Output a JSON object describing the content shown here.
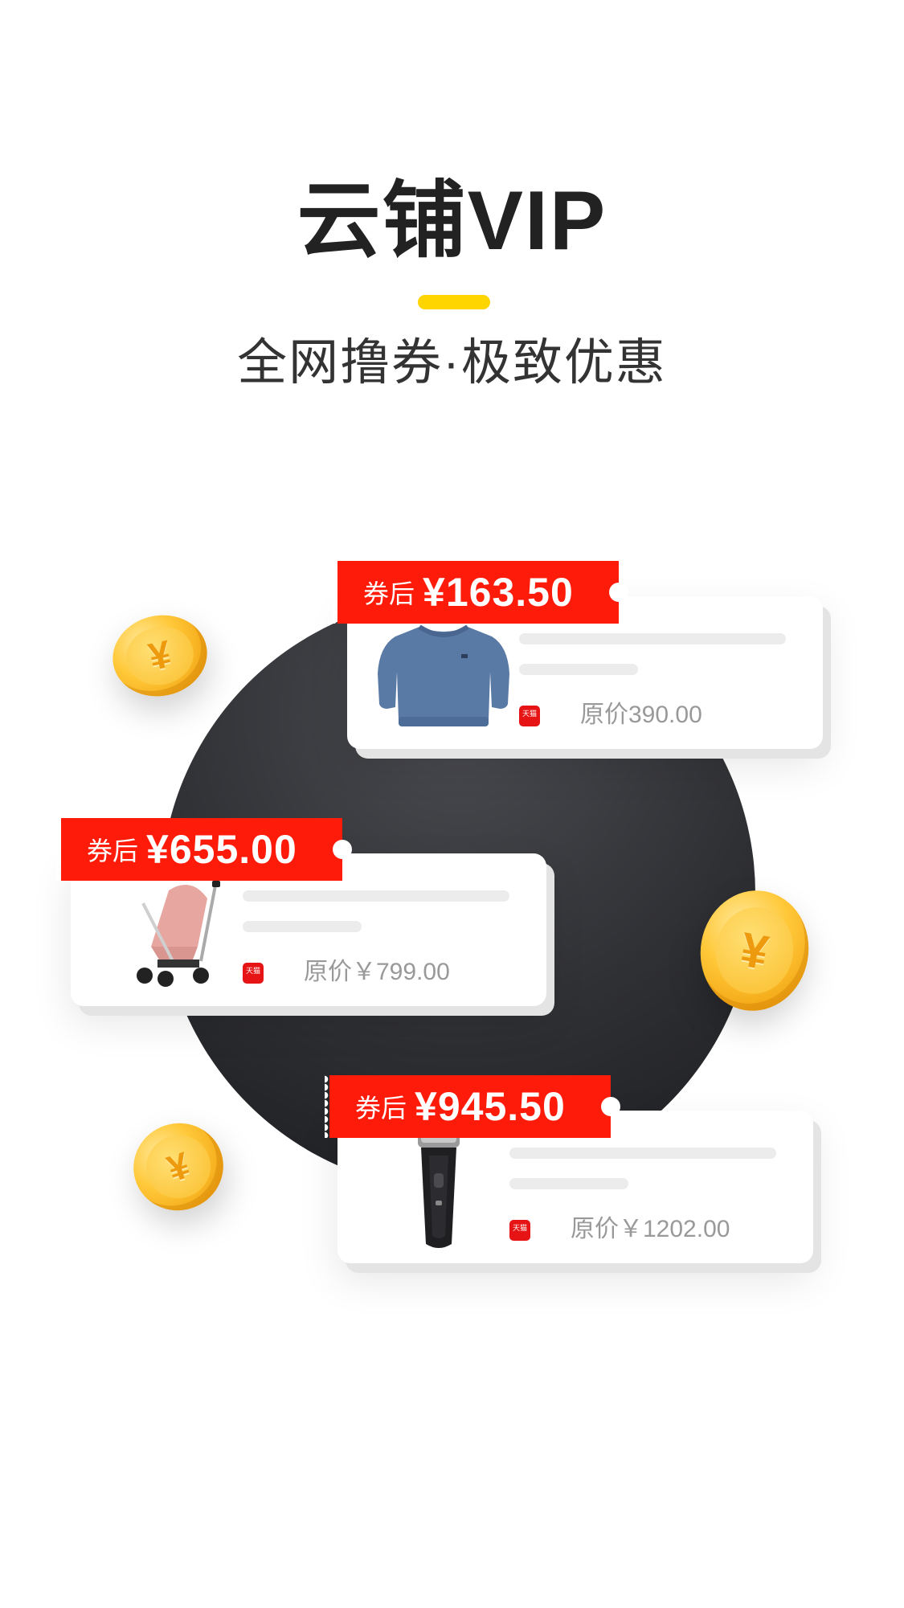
{
  "header": {
    "title": "云铺VIP",
    "subtitle": "全网撸券·极致优惠"
  },
  "coin_symbol": "¥",
  "products": [
    {
      "coupon_label": "券后",
      "coupon_price": "¥163.50",
      "store_icon_text": "天猫",
      "original_price": "原价390.00",
      "image": "sweatshirt"
    },
    {
      "coupon_label": "券后",
      "coupon_price": "¥655.00",
      "store_icon_text": "天猫",
      "original_price": "原价￥799.00",
      "image": "baby-stroller"
    },
    {
      "coupon_label": "券后",
      "coupon_price": "¥945.50",
      "store_icon_text": "天猫",
      "original_price": "原价￥1202.00",
      "image": "electric-shaver"
    }
  ],
  "colors": {
    "accent_yellow": "#ffd500",
    "coupon_red": "#ff1b0a",
    "coin_gold": "#ffc93a",
    "circle_dark": "#2f3034"
  }
}
